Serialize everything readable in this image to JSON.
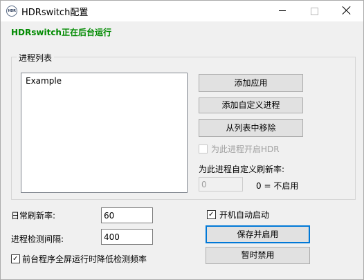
{
  "window": {
    "title": "HDRswitch配置",
    "icon_text": "HDR"
  },
  "status": {
    "text": "HDRswitch正在后台运行",
    "color": "#008a00"
  },
  "process_group": {
    "label": "进程列表",
    "list_items": [
      "Example"
    ],
    "buttons": {
      "add_app": "添加应用",
      "add_custom": "添加自定义进程",
      "remove": "从列表中移除"
    },
    "enable_hdr": {
      "label": "为此进程开启HDR",
      "checked": false,
      "enabled": false
    },
    "custom_refresh_label": "为此进程自定义刷新率:",
    "custom_refresh_value": "0",
    "zero_note": "0 = 不启用"
  },
  "settings": {
    "daily_refresh_label": "日常刷新率:",
    "daily_refresh_value": "60",
    "interval_label": "进程检测间隔:",
    "interval_value": "400",
    "foreground_reduce": {
      "label": "前台程序全屏运行时降低检测频率",
      "checked": true
    },
    "autostart": {
      "label": "开机自动启动",
      "checked": true
    }
  },
  "actions": {
    "save_enable": "保存并启用",
    "temp_disable": "暂时禁用"
  }
}
